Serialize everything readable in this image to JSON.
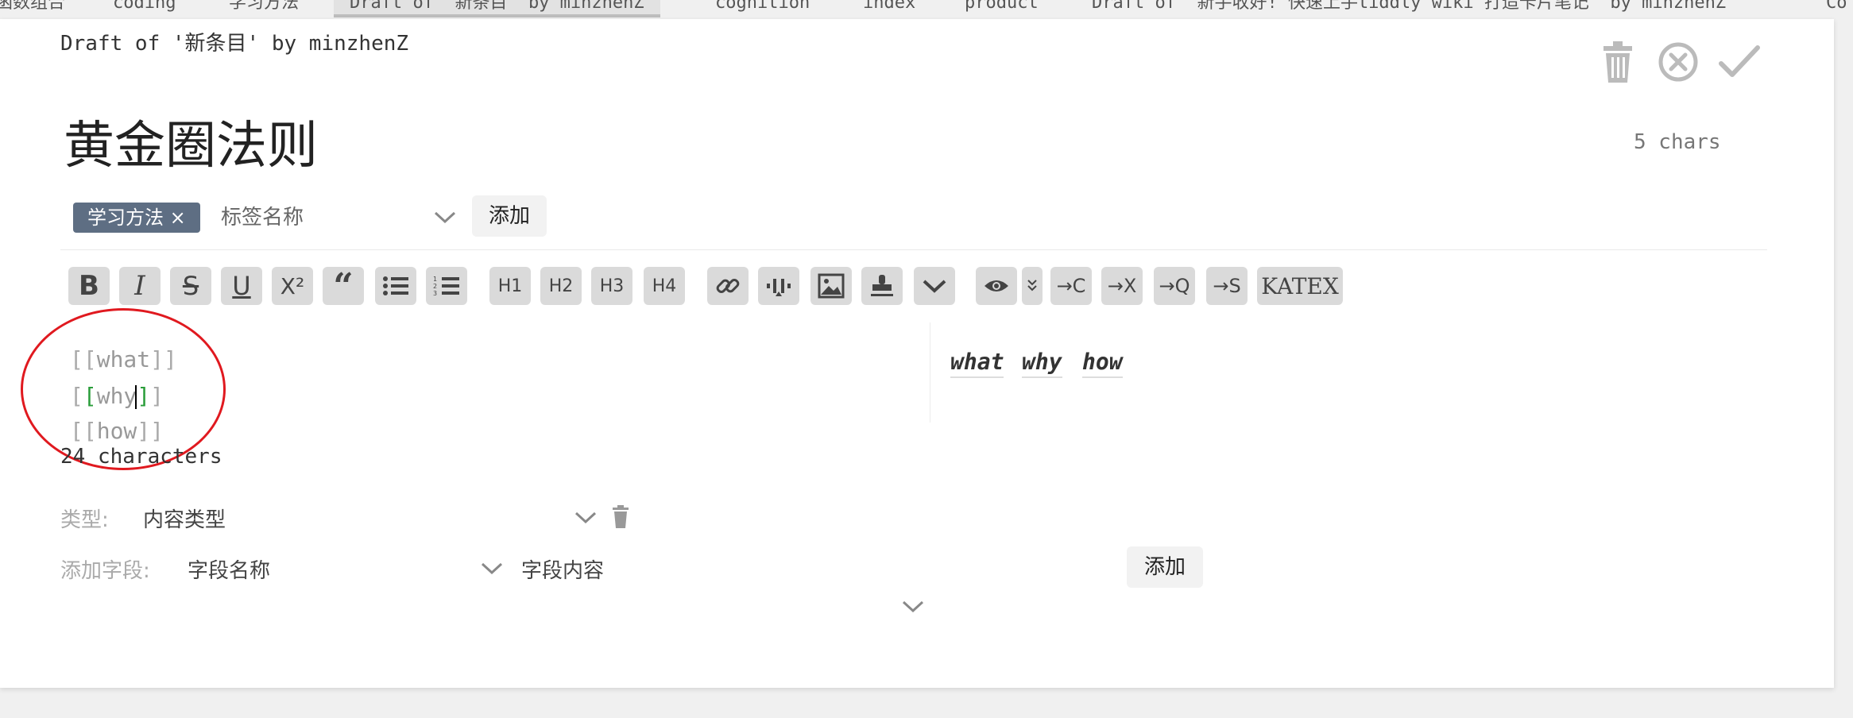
{
  "tabs": [
    {
      "label": "函数组合"
    },
    {
      "label": "coding"
    },
    {
      "label": "学习方法"
    },
    {
      "label": "Draft of '新条目' by minzhenZ"
    },
    {
      "label": "cognition"
    },
    {
      "label": "index"
    },
    {
      "label": "product"
    },
    {
      "label": "Draft of '新手收好! 快速上手tiddly wiki 打造卡片笔记' by minzhenZ"
    },
    {
      "label": "Co"
    }
  ],
  "draft": {
    "title": "Draft of '新条目' by minzhenZ",
    "heading": "黄金圈法则",
    "char_count": "5 chars"
  },
  "tags": {
    "pill_label": "学习方法 ×",
    "input_placeholder": "标签名称",
    "add_label": "添加"
  },
  "toolbar": {
    "h1": "H1",
    "h2": "H2",
    "h3": "H3",
    "h4": "H4",
    "katex": "KATEX"
  },
  "editor": {
    "lines": [
      "what",
      "why",
      "how"
    ],
    "preview_links": [
      "what",
      "why",
      "how"
    ],
    "characters": "24 characters"
  },
  "fields": {
    "type_label": "类型:",
    "type_placeholder": "内容类型",
    "add_field_label": "添加字段:",
    "field_name_placeholder": "字段名称",
    "field_value_placeholder": "字段内容",
    "add_label": "添加"
  },
  "colors": {
    "tag_pill": "#5e6e83",
    "annotation_circle": "#e0191f",
    "bracket_active": "#2a9d3a"
  }
}
